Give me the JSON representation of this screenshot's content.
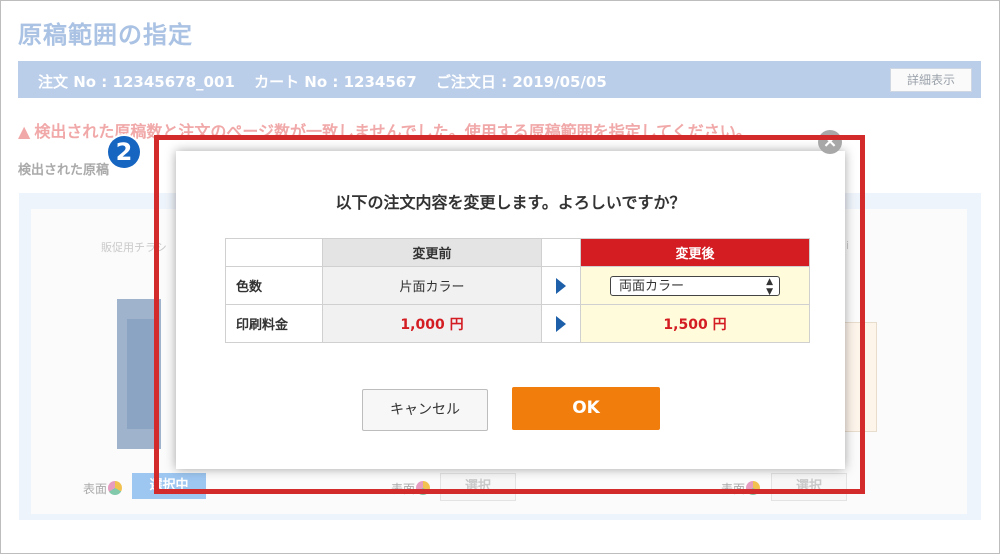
{
  "page": {
    "title": "原稿範囲の指定",
    "order_no": "注文 No : 12345678_001",
    "cart_no": "カート No : 1234567",
    "order_date": "ご注文日 : 2019/05/05",
    "detail_button": "詳細表示",
    "warning": "検出された原稿数と注文のページ数が一致しませんでした。使用する原稿範囲を指定してください。",
    "detected_label": "検出された原稿",
    "column_heading_left": "販促用チラシ",
    "column_heading_right": "i",
    "columns": [
      {
        "face_label": "表面",
        "select_label": "選択中",
        "active": true
      },
      {
        "face_label": "表面",
        "select_label": "選択",
        "active": false
      },
      {
        "face_label": "表面",
        "select_label": "選択",
        "active": false
      }
    ]
  },
  "modal": {
    "message": "以下の注文内容を変更します。よろしいですか？",
    "header_before": "変更前",
    "header_after": "変更後",
    "rows": [
      {
        "label": "色数",
        "before": "片面カラー",
        "after": "両面カラー"
      },
      {
        "label": "印刷料金",
        "before": "1,000 円",
        "after": "1,500 円"
      }
    ],
    "cancel_label": "キャンセル",
    "ok_label": "OK",
    "close_glyph": "×"
  },
  "annotation": {
    "step_number": "2"
  },
  "colors": {
    "accent_red": "#d31d23",
    "ok_orange": "#f07d0c",
    "badge_blue": "#1665c1",
    "highlight_red": "#d32b2b"
  }
}
